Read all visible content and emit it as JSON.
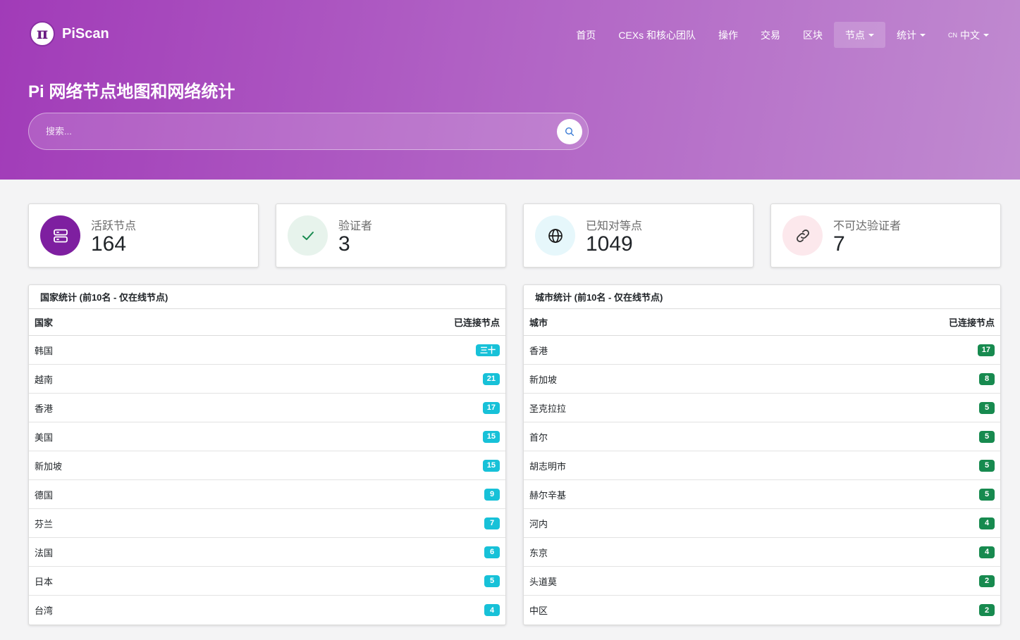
{
  "brand": {
    "name": "PiScan",
    "logo_glyph": "π"
  },
  "nav": {
    "items": [
      {
        "label": "首页",
        "dropdown": false,
        "active": false
      },
      {
        "label": "CEXs 和核心团队",
        "dropdown": false,
        "active": false
      },
      {
        "label": "操作",
        "dropdown": false,
        "active": false
      },
      {
        "label": "交易",
        "dropdown": false,
        "active": false
      },
      {
        "label": "区块",
        "dropdown": false,
        "active": false
      },
      {
        "label": "节点",
        "dropdown": true,
        "active": true
      },
      {
        "label": "统计",
        "dropdown": true,
        "active": false
      }
    ],
    "language": {
      "code": "CN",
      "label": "中文"
    }
  },
  "hero": {
    "title": "Pi 网络节点地图和网络统计"
  },
  "search": {
    "placeholder": "搜索..."
  },
  "stats": [
    {
      "label": "活跃节点",
      "value": "164",
      "icon": "server-icon",
      "bg": "#7e1fa0",
      "fg": "#ffffff"
    },
    {
      "label": "验证者",
      "value": "3",
      "icon": "check-icon",
      "bg": "#e7f3ec",
      "fg": "#178a4f"
    },
    {
      "label": "已知对等点",
      "value": "1049",
      "icon": "globe-icon",
      "bg": "#e6f7fb",
      "fg": "#1b1b1b"
    },
    {
      "label": "不可达验证者",
      "value": "7",
      "icon": "link-icon",
      "bg": "#fce8ec",
      "fg": "#3a3a3a"
    }
  ],
  "country_panel": {
    "title": "国家统计 (前10名 - 仅在线节点)",
    "col_name": "国家",
    "col_count": "已连接节点",
    "rows": [
      {
        "name": "韩国",
        "count": "三十"
      },
      {
        "name": "越南",
        "count": "21"
      },
      {
        "name": "香港",
        "count": "17"
      },
      {
        "name": "美国",
        "count": "15"
      },
      {
        "name": "新加坡",
        "count": "15"
      },
      {
        "name": "德国",
        "count": "9"
      },
      {
        "name": "芬兰",
        "count": "7"
      },
      {
        "name": "法国",
        "count": "6"
      },
      {
        "name": "日本",
        "count": "5"
      },
      {
        "name": "台湾",
        "count": "4"
      }
    ]
  },
  "city_panel": {
    "title": "城市统计 (前10名 - 仅在线节点)",
    "col_name": "城市",
    "col_count": "已连接节点",
    "rows": [
      {
        "name": "香港",
        "count": "17"
      },
      {
        "name": "新加坡",
        "count": "8"
      },
      {
        "name": "圣克拉拉",
        "count": "5"
      },
      {
        "name": "首尔",
        "count": "5"
      },
      {
        "name": "胡志明市",
        "count": "5"
      },
      {
        "name": "赫尔辛基",
        "count": "5"
      },
      {
        "name": "河内",
        "count": "4"
      },
      {
        "name": "东京",
        "count": "4"
      },
      {
        "name": "头道莫",
        "count": "2"
      },
      {
        "name": "中区",
        "count": "2"
      }
    ]
  },
  "colors": {
    "country_badge": "#17c1d8",
    "city_badge": "#178a4f",
    "brand": "#a13bb8"
  }
}
